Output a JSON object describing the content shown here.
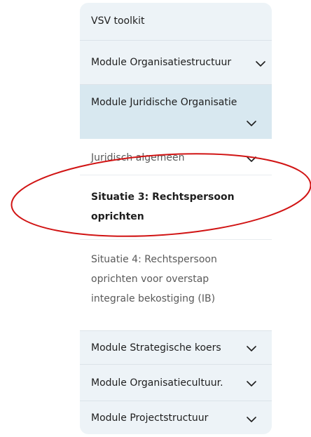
{
  "nav": {
    "items": [
      {
        "label": "VSV toolkit"
      },
      {
        "label": "Module Organisatiestructuur"
      },
      {
        "label": "Module Juridische Organisatie"
      },
      {
        "label": "Juridisch algemeen"
      },
      {
        "label": "Situatie 3: Rechtspersoon oprichten"
      },
      {
        "label": "Situatie 4: Rechtspersoon oprichten voor overstap integrale bekostiging (IB)"
      },
      {
        "label": "Module Strategische koers"
      },
      {
        "label": "Module Organisatiecultuur."
      },
      {
        "label": "Module Projectstructuur"
      }
    ]
  },
  "colors": {
    "panel_bg": "#edf3f7",
    "active_bg": "#d8e8f0",
    "annotation_red": "#d11414"
  },
  "icons": {
    "chevron": "chevron-down-icon"
  }
}
